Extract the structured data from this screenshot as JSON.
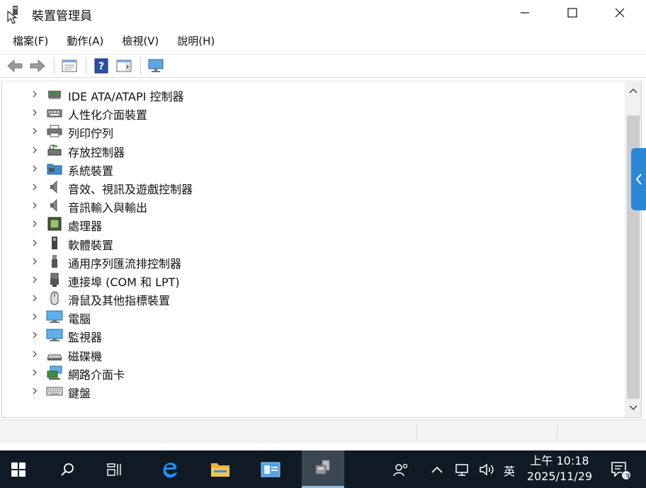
{
  "window": {
    "title": "裝置管理員",
    "controls": {
      "minimize": "minimize",
      "maximize": "maximize",
      "close": "close"
    }
  },
  "menu": {
    "items": [
      {
        "label": "檔案(F)"
      },
      {
        "label": "動作(A)"
      },
      {
        "label": "檢視(V)"
      },
      {
        "label": "說明(H)"
      }
    ]
  },
  "toolbar": {
    "buttons": [
      {
        "icon": "back-arrow-icon"
      },
      {
        "icon": "forward-arrow-icon"
      },
      {
        "icon": "properties-view-icon"
      },
      {
        "icon": "help-icon"
      },
      {
        "icon": "action-pane-icon"
      },
      {
        "icon": "monitor-scan-icon"
      }
    ]
  },
  "tree": {
    "items": [
      {
        "label": "IDE ATA/ATAPI 控制器",
        "icon": "ide-controller-icon"
      },
      {
        "label": "人性化介面裝置",
        "icon": "hid-icon"
      },
      {
        "label": "列印佇列",
        "icon": "printer-icon"
      },
      {
        "label": "存放控制器",
        "icon": "storage-controller-icon"
      },
      {
        "label": "系統裝置",
        "icon": "system-folder-icon"
      },
      {
        "label": "音效、視訊及遊戲控制器",
        "icon": "speaker-icon"
      },
      {
        "label": "音訊輸入與輸出",
        "icon": "audio-io-icon"
      },
      {
        "label": "處理器",
        "icon": "processor-icon"
      },
      {
        "label": "軟體裝置",
        "icon": "software-device-icon"
      },
      {
        "label": "通用序列匯流排控制器",
        "icon": "usb-icon"
      },
      {
        "label": "連接埠 (COM 和 LPT)",
        "icon": "port-icon"
      },
      {
        "label": "滑鼠及其他指標裝置",
        "icon": "mouse-icon"
      },
      {
        "label": "電腦",
        "icon": "computer-icon"
      },
      {
        "label": "監視器",
        "icon": "monitor-icon"
      },
      {
        "label": "磁碟機",
        "icon": "disk-drive-icon"
      },
      {
        "label": "網路介面卡",
        "icon": "network-adapter-icon"
      },
      {
        "label": "鍵盤",
        "icon": "keyboard-icon"
      }
    ]
  },
  "taskbar": {
    "tray_ime": "英",
    "clock_time": "上午 10:18",
    "clock_date": "2025/11/29",
    "notification_count": "3"
  },
  "colors": {
    "accent": "#2b88d8",
    "taskbar": "#0f1a24"
  }
}
